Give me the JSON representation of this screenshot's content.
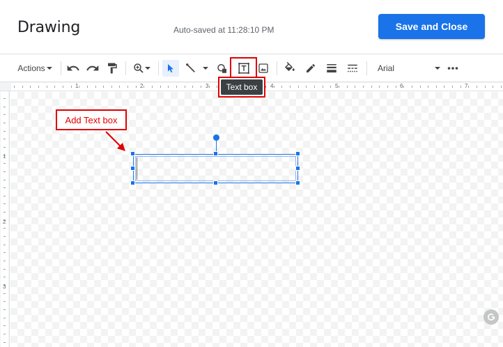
{
  "header": {
    "title": "Drawing",
    "autosave": "Auto-saved at 11:28:10 PM",
    "save_button": "Save and Close"
  },
  "toolbar": {
    "actions_label": "Actions",
    "font": "Arial",
    "tooltip": "Text box",
    "buttons": [
      "undo-icon",
      "redo-icon",
      "paint-format-icon",
      "zoom-icon",
      "select-icon",
      "line-icon",
      "shape-icon",
      "text-box-icon",
      "image-icon",
      "fill-color-icon",
      "border-color-icon",
      "border-weight-icon",
      "border-dash-icon",
      "more-icon"
    ]
  },
  "ruler": {
    "horizontal": [
      "1",
      "2",
      "3",
      "4",
      "5",
      "6",
      "7"
    ],
    "vertical": [
      "1",
      "2",
      "3"
    ]
  },
  "canvas": {
    "annotation": "Add Text box",
    "annotation_color": "#e00000",
    "selection_color": "#1a73e8"
  }
}
